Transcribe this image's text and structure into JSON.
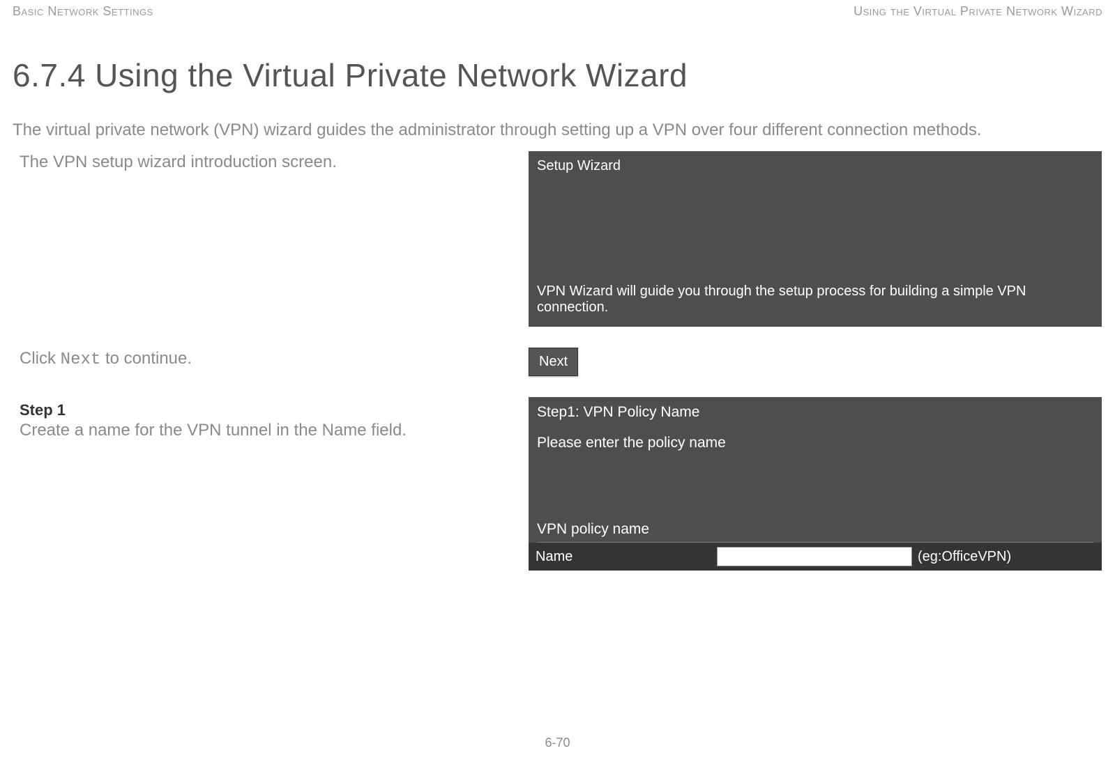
{
  "header": {
    "left": "Basic Network Settings",
    "right": "Using the Virtual Private Network Wizard"
  },
  "heading": "6.7.4 Using the Virtual Private Network Wizard",
  "intro": "The virtual private network (VPN) wizard guides the administrator through setting up a VPN over four different connection methods.",
  "row1": {
    "desc": "The VPN setup wizard introduction screen.",
    "panel_title": "Setup Wizard",
    "panel_text": "VPN Wizard will guide you through the setup process for building a simple VPN connection."
  },
  "row2": {
    "desc_before": "Click ",
    "desc_code": "Next",
    "desc_after": " to continue.",
    "button": "Next"
  },
  "row3": {
    "step_title": "Step 1",
    "desc": "Create a name for the VPN tunnel in the Name field.",
    "panel_title": "Step1: VPN Policy Name",
    "panel_prompt": "Please enter the policy name",
    "section_label": "VPN policy name",
    "name_label": "Name",
    "name_value": "",
    "name_placeholder": "",
    "name_hint": "(eg:OfficeVPN)"
  },
  "page_number": "6-70"
}
